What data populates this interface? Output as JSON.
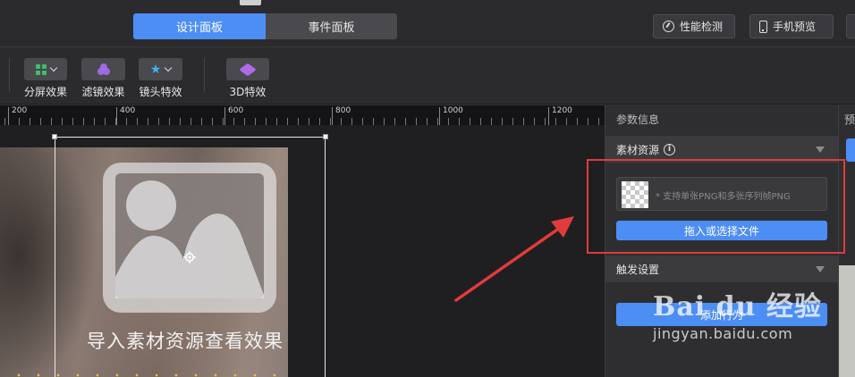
{
  "header": {
    "tabs": [
      {
        "label": "设计面板",
        "active": true
      },
      {
        "label": "事件面板",
        "active": false
      }
    ],
    "buttons": {
      "performance": "性能检测",
      "phone_preview": "手机预览"
    }
  },
  "toolbar": {
    "tools": [
      {
        "label": "分屏效果",
        "icon": "grid-icon"
      },
      {
        "label": "滤镜效果",
        "icon": "filter-circles-icon"
      },
      {
        "label": "镜头特效",
        "icon": "star-icon"
      },
      {
        "label": "3D特效",
        "icon": "cube-icon"
      }
    ]
  },
  "ruler": {
    "labels": [
      "200",
      "400",
      "600",
      "800",
      "1000",
      "1200"
    ]
  },
  "canvas": {
    "overlay_text": "导入素材资源查看效果"
  },
  "panel": {
    "title": "参数信息",
    "material_section": "素材资源",
    "info_icon": "i",
    "drop_placeholder": "* 支持单张PNG和多张序列帧PNG",
    "choose_file_button": "拖入或选择文件",
    "trigger_section": "触发设置",
    "add_button": "添加行为"
  },
  "right_panel": {
    "label_partial": "预"
  },
  "watermark": {
    "brand": "Bai du 经验",
    "url": "jingyan.baidu.com"
  },
  "colors": {
    "accent": "#4d8ef5",
    "annotation": "#e23b3b",
    "background": "#1f1f22"
  }
}
